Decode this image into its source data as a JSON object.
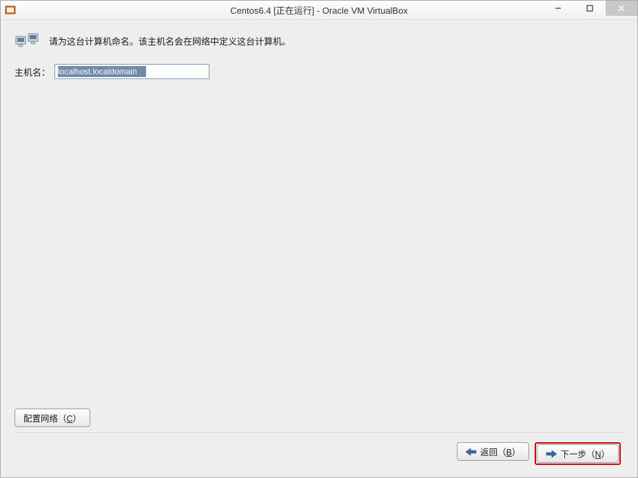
{
  "titlebar": {
    "title": "Centos6.4 [正在运行] - Oracle VM VirtualBox"
  },
  "header": {
    "text": "请为这台计算机命名。该主机名会在网络中定义这台计算机。"
  },
  "form": {
    "hostname_label": "主机名：",
    "hostname_value": "localhost.localdomain"
  },
  "buttons": {
    "configure_network": "配置网络（",
    "configure_network_accel": "C",
    "configure_network_suffix": "）",
    "back": "返回（",
    "back_accel": "B",
    "back_suffix": "）",
    "next": "下一步（",
    "next_accel": "N",
    "next_suffix": "）"
  }
}
